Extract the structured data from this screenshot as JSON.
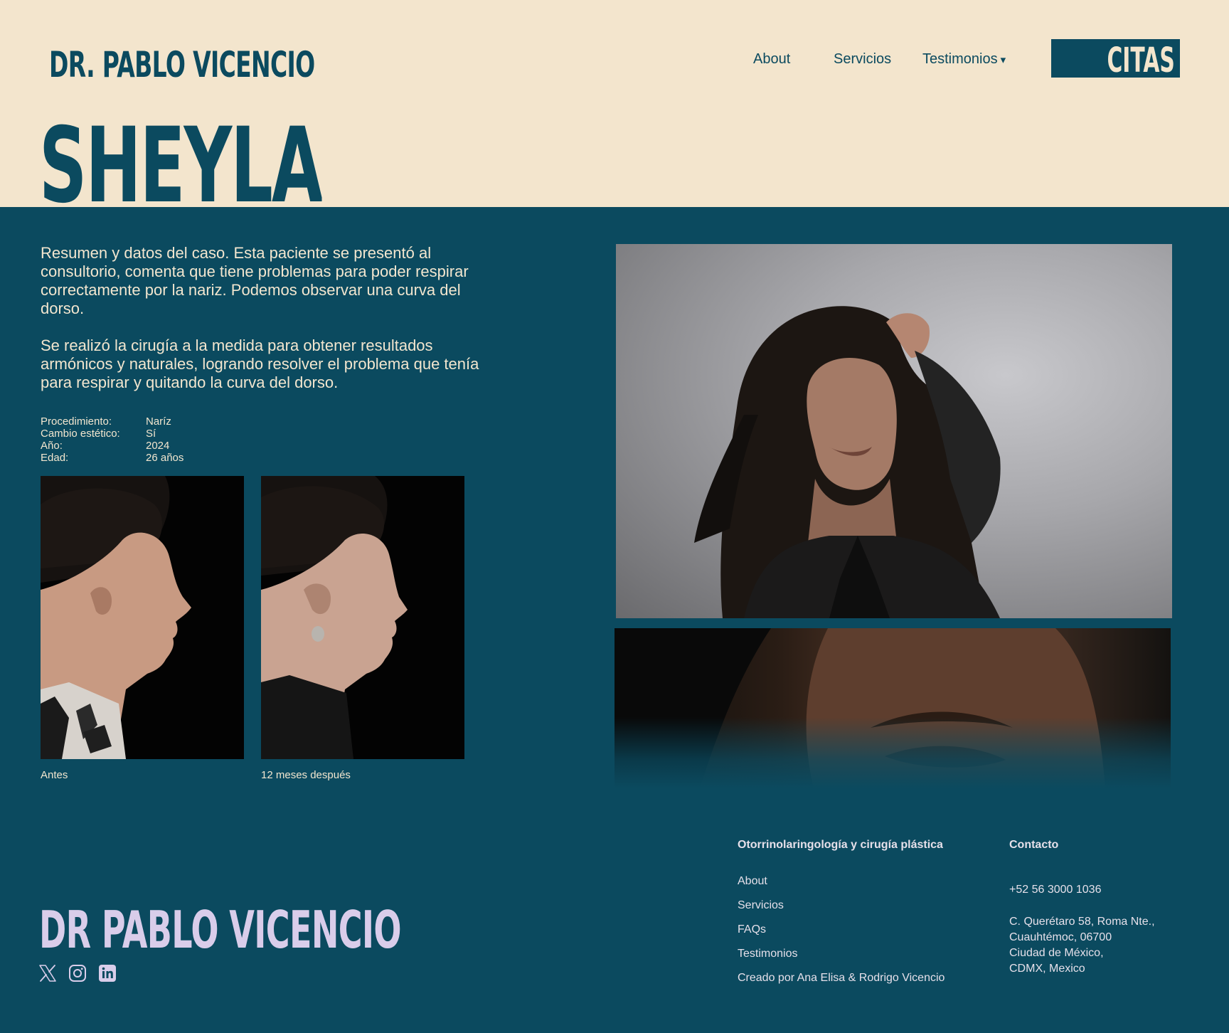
{
  "header": {
    "brand": "DR. PABLO VICENCIO",
    "nav": {
      "about": "About",
      "servicios": "Servicios",
      "testimonios": "Testimonios",
      "testimonios_caret": "▾"
    },
    "cta_label": "CITAS"
  },
  "patient": {
    "name": "SHEYLA",
    "summary": [
      "Resumen y datos del caso. Esta paciente se presentó al consultorio, comenta que tiene problemas para poder respirar correctamente por la nariz. Podemos observar una curva del dorso.",
      "Se realizó la cirugía a la medida para obtener resultados armónicos y naturales, logrando resolver el problema que tenía para respirar y quitando la curva del dorso."
    ],
    "facts": [
      {
        "label": "Procedimiento:",
        "value": "Naríz"
      },
      {
        "label": "Cambio estético:",
        "value": "Sí"
      },
      {
        "label": "Año:",
        "value": "2024"
      },
      {
        "label": "Edad:",
        "value": "26 años"
      }
    ],
    "captions": {
      "before": "Antes",
      "after": "12 meses después"
    }
  },
  "footer": {
    "brand": "DR PABLO VICENCIO",
    "specialty_heading": "Otorrinolaringología y cirugía plástica",
    "links": [
      "About",
      "Servicios",
      "FAQs",
      "Testimonios",
      "Creado por Ana Elisa & Rodrigo Vicencio"
    ],
    "contact_heading": "Contacto",
    "phone": "+52 56 3000 1036",
    "address": [
      "C. Querétaro 58, Roma Nte.,",
      "Cuauhtémoc, 06700",
      "Ciudad de México,",
      "CDMX, Mexico"
    ],
    "social_icons": [
      "x-icon",
      "instagram-icon",
      "linkedin-icon"
    ]
  },
  "colors": {
    "cream": "#f3e5cd",
    "teal": "#0b4a5f",
    "lavender": "#d9cdea"
  }
}
